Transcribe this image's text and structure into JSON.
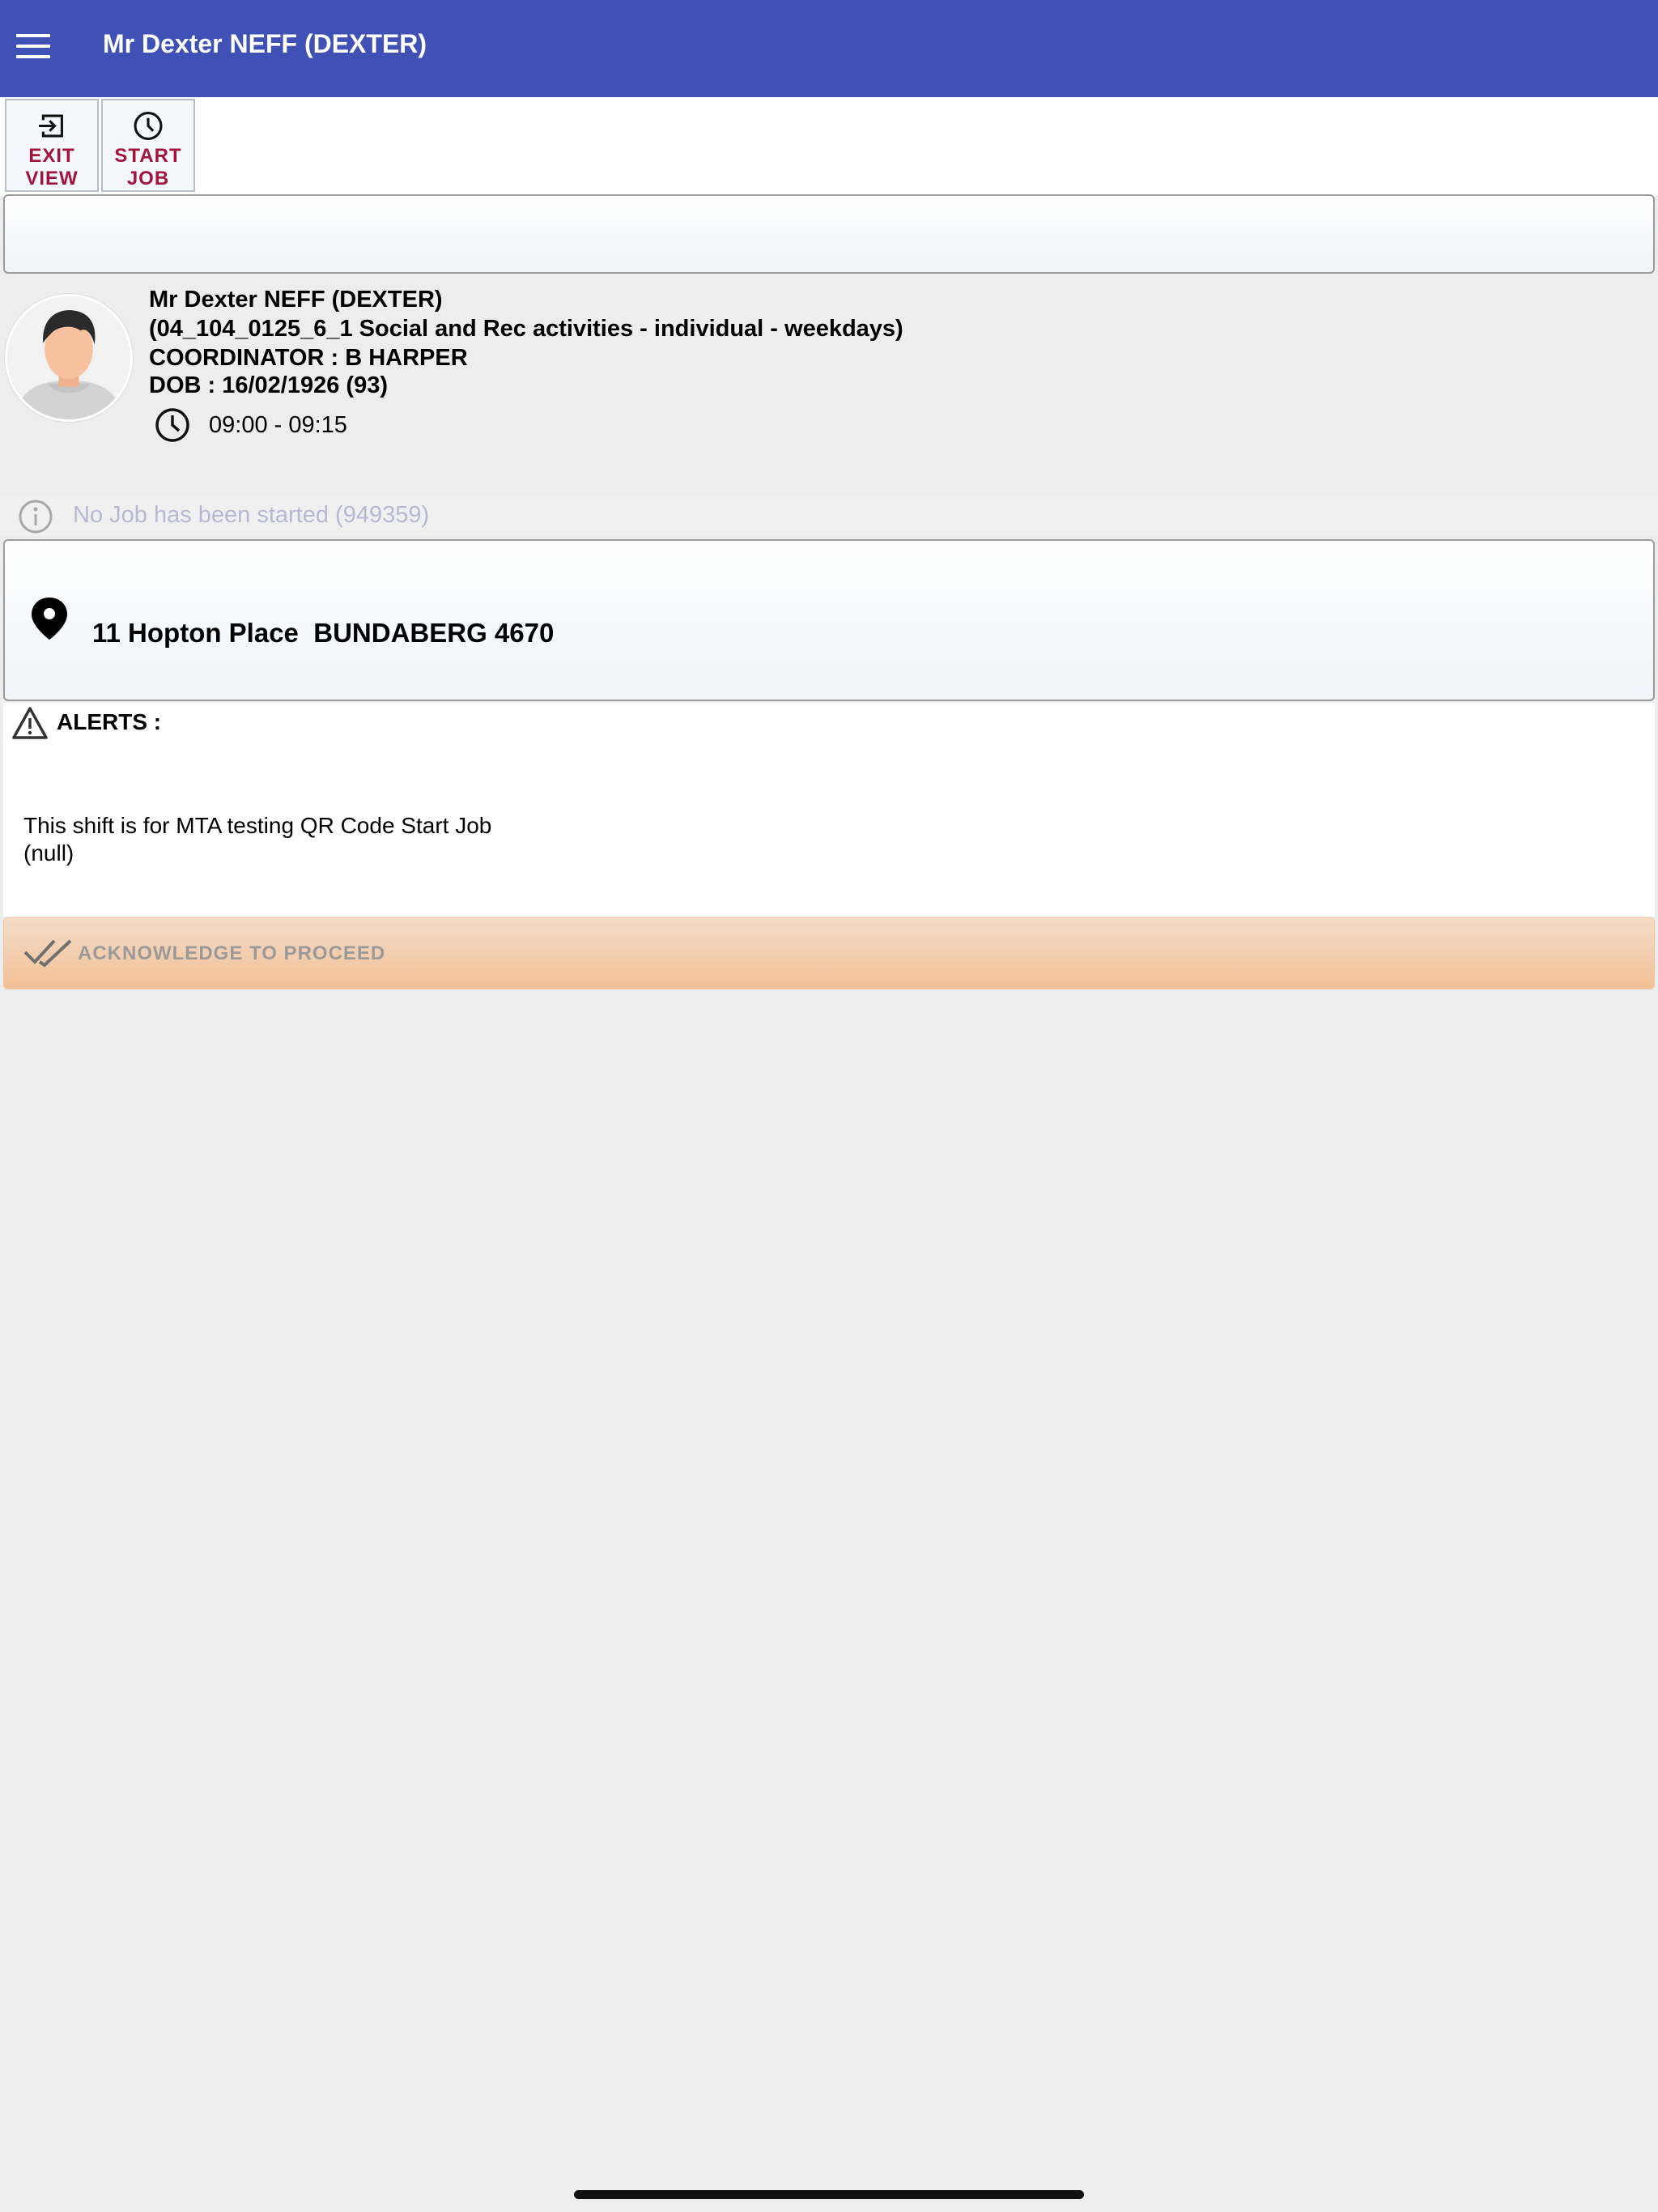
{
  "appbar": {
    "title": "Mr Dexter NEFF (DEXTER)",
    "menu_icon": "hamburger-menu-icon",
    "color": "#3f51b5"
  },
  "toolbar": {
    "exit_view": {
      "label_line1": "EXIT",
      "label_line2": "VIEW",
      "icon": "exit-icon"
    },
    "start_job": {
      "label_line1": "START",
      "label_line2": "JOB",
      "icon": "clock-icon"
    },
    "label_color": "#a3133c"
  },
  "client": {
    "name": "Mr Dexter NEFF (DEXTER)",
    "service": "(04_104_0125_6_1 Social and Rec activities - individual - weekdays)",
    "coordinator": "COORDINATOR : B HARPER",
    "dob": "DOB : 16/02/1926 (93)",
    "time": "09:00 - 09:15",
    "avatar_icon": "user-avatar-icon"
  },
  "status": {
    "text": "No Job has been started (949359)",
    "icon": "info-icon"
  },
  "address": {
    "text": "11 Hopton Place  BUNDABERG 4670",
    "icon": "map-pin-icon"
  },
  "alerts": {
    "heading": "ALERTS :",
    "icon": "warning-icon",
    "line1": "This shift is for MTA testing QR Code Start Job",
    "line2": "(null)"
  },
  "acknowledge": {
    "label": "ACKNOWLEDGE TO PROCEED",
    "icon": "double-check-icon"
  }
}
